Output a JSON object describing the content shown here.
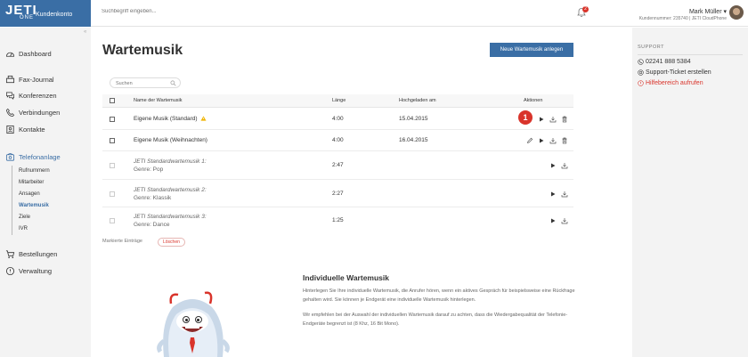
{
  "brand": {
    "name": "JETI",
    "sub": "ONE",
    "section": "Kundenkonto",
    "color": "#3a6ea5"
  },
  "topbar": {
    "search_placeholder": "Suchbegriff eingeben...",
    "notification_count": "2",
    "user_name": "Mark Müller ▾",
    "user_sub": "Kundennummer: 235740 | JETI CloudPhone"
  },
  "sidebar": {
    "collapse": "«",
    "items": [
      {
        "label": "Dashboard",
        "icon": "dashboard-icon"
      },
      {
        "label": "Fax-Journal",
        "icon": "fax-icon"
      },
      {
        "label": "Konferenzen",
        "icon": "conference-icon"
      },
      {
        "label": "Verbindungen",
        "icon": "phone-icon"
      },
      {
        "label": "Kontakte",
        "icon": "contacts-icon"
      },
      {
        "label": "Telefonanlage",
        "icon": "pbx-icon"
      },
      {
        "label": "Bestellungen",
        "icon": "cart-icon"
      },
      {
        "label": "Verwaltung",
        "icon": "settings-icon"
      }
    ],
    "subitems": [
      "Rufnummern",
      "Mitarbeiter",
      "Ansagen",
      "Wartemusik",
      "Ziele",
      "IVR"
    ]
  },
  "main": {
    "title": "Wartemusik",
    "new_button": "Neue Wartemusik anlegen",
    "search_placeholder": "Suchen",
    "columns": [
      "Name der Wartemusik",
      "Länge",
      "Hochgeladen am",
      "Aktionen"
    ],
    "rows": [
      {
        "name": "Eigene Musik (Standard)",
        "length": "4:00",
        "date": "15.04.2015"
      },
      {
        "name": "Eigene Musik (Weihnachten)",
        "length": "4:00",
        "date": "16.04.2015"
      },
      {
        "name1": "JETI Standardwartemusik 1:",
        "name2": "Genre: Pop",
        "length": "2:47"
      },
      {
        "name1": "JETI Standardwartemusik 2:",
        "name2": "Genre: Klassik",
        "length": "2:27"
      },
      {
        "name1": "JETI Standardwartemusik 3:",
        "name2": "Genre: Dance",
        "length": "1:25"
      }
    ],
    "marker": "1",
    "bulk_label": "Markierte Einträge",
    "delete_button": "Löschen",
    "info": {
      "title": "Individuelle Wartemusik",
      "p1": "Hinterlegen Sie Ihre individuelle Wartemusik, die Anrufer hören, wenn ein aktives Gespräch für beispielsweise eine Rückfrage gehalten wird. Sie können je Endgerät eine individuelle Wartemusik hinterlegen.",
      "p2": "Wir empfehlen bei der Auswahl der individuellen Wartemusik darauf zu achten, dass die Wiedergabequalität der Telefonie-Endgeräte begrenzt ist (8 Khz, 16 Bit Mono)."
    }
  },
  "support": {
    "heading": "SUPPORT",
    "phone": "02241 888 5384",
    "ticket": "Support-Ticket erstellen",
    "help": "Hilfebereich aufrufen"
  }
}
